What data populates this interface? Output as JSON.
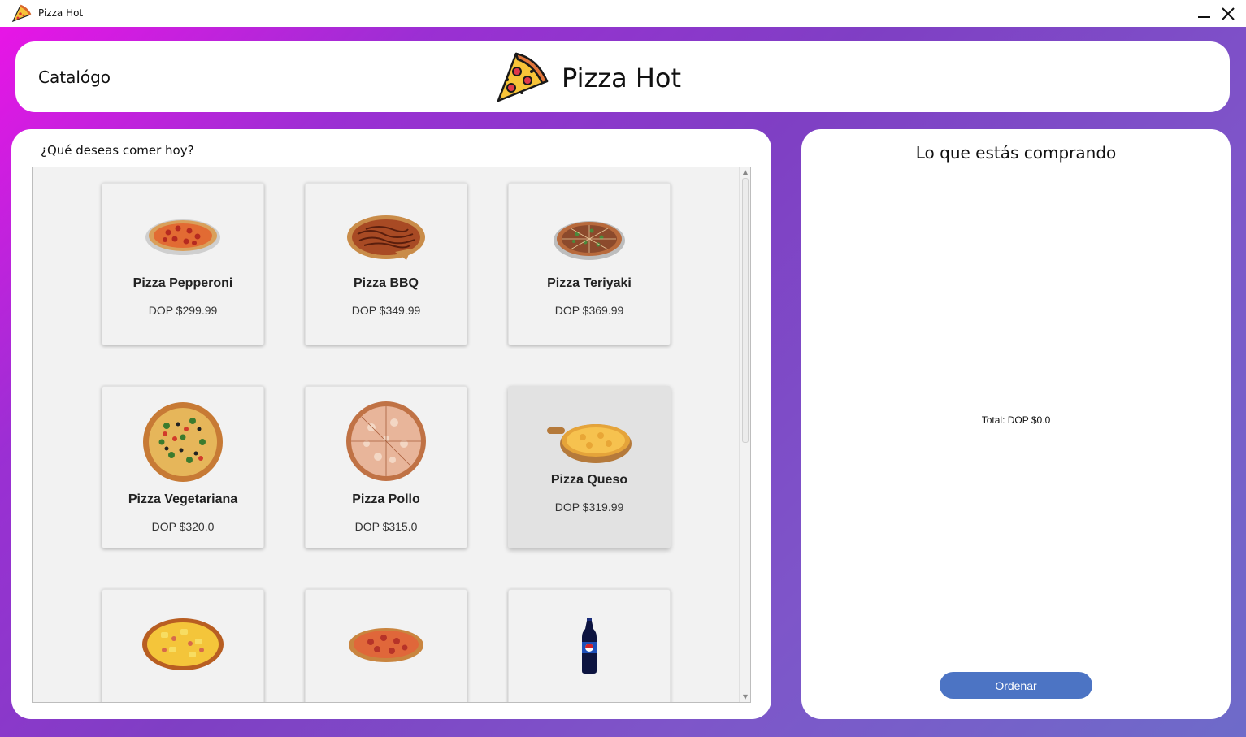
{
  "window": {
    "title": "Pizza Hot"
  },
  "header": {
    "nav_label": "Catalógo",
    "brand_name": "Pizza Hot"
  },
  "catalog": {
    "prompt": "¿Qué deseas comer hoy?",
    "products": [
      {
        "name": "Pizza Pepperoni",
        "price": "DOP $299.99",
        "image": "pepperoni-pizza"
      },
      {
        "name": "Pizza BBQ",
        "price": "DOP $349.99",
        "image": "bbq-pizza"
      },
      {
        "name": "Pizza Teriyaki",
        "price": "DOP $369.99",
        "image": "teriyaki-pizza"
      },
      {
        "name": "Pizza Vegetariana",
        "price": "DOP $320.0",
        "image": "vegetarian-pizza"
      },
      {
        "name": "Pizza Pollo",
        "price": "DOP $315.0",
        "image": "chicken-pizza"
      },
      {
        "name": "Pizza Queso",
        "price": "DOP $319.99",
        "image": "cheese-pizza"
      },
      {
        "name": "",
        "price": "",
        "image": "hawaiian-pizza"
      },
      {
        "name": "",
        "price": "",
        "image": "tuna-pizza"
      },
      {
        "name": "",
        "price": "",
        "image": "pepsi-bottle"
      }
    ]
  },
  "cart": {
    "title": "Lo que estás comprando",
    "total": "Total: DOP $0.0",
    "order_label": "Ordenar"
  },
  "colors": {
    "accent": "#4c74c4",
    "gradient_start": "#e815e6",
    "gradient_end": "#6e6bc9"
  }
}
